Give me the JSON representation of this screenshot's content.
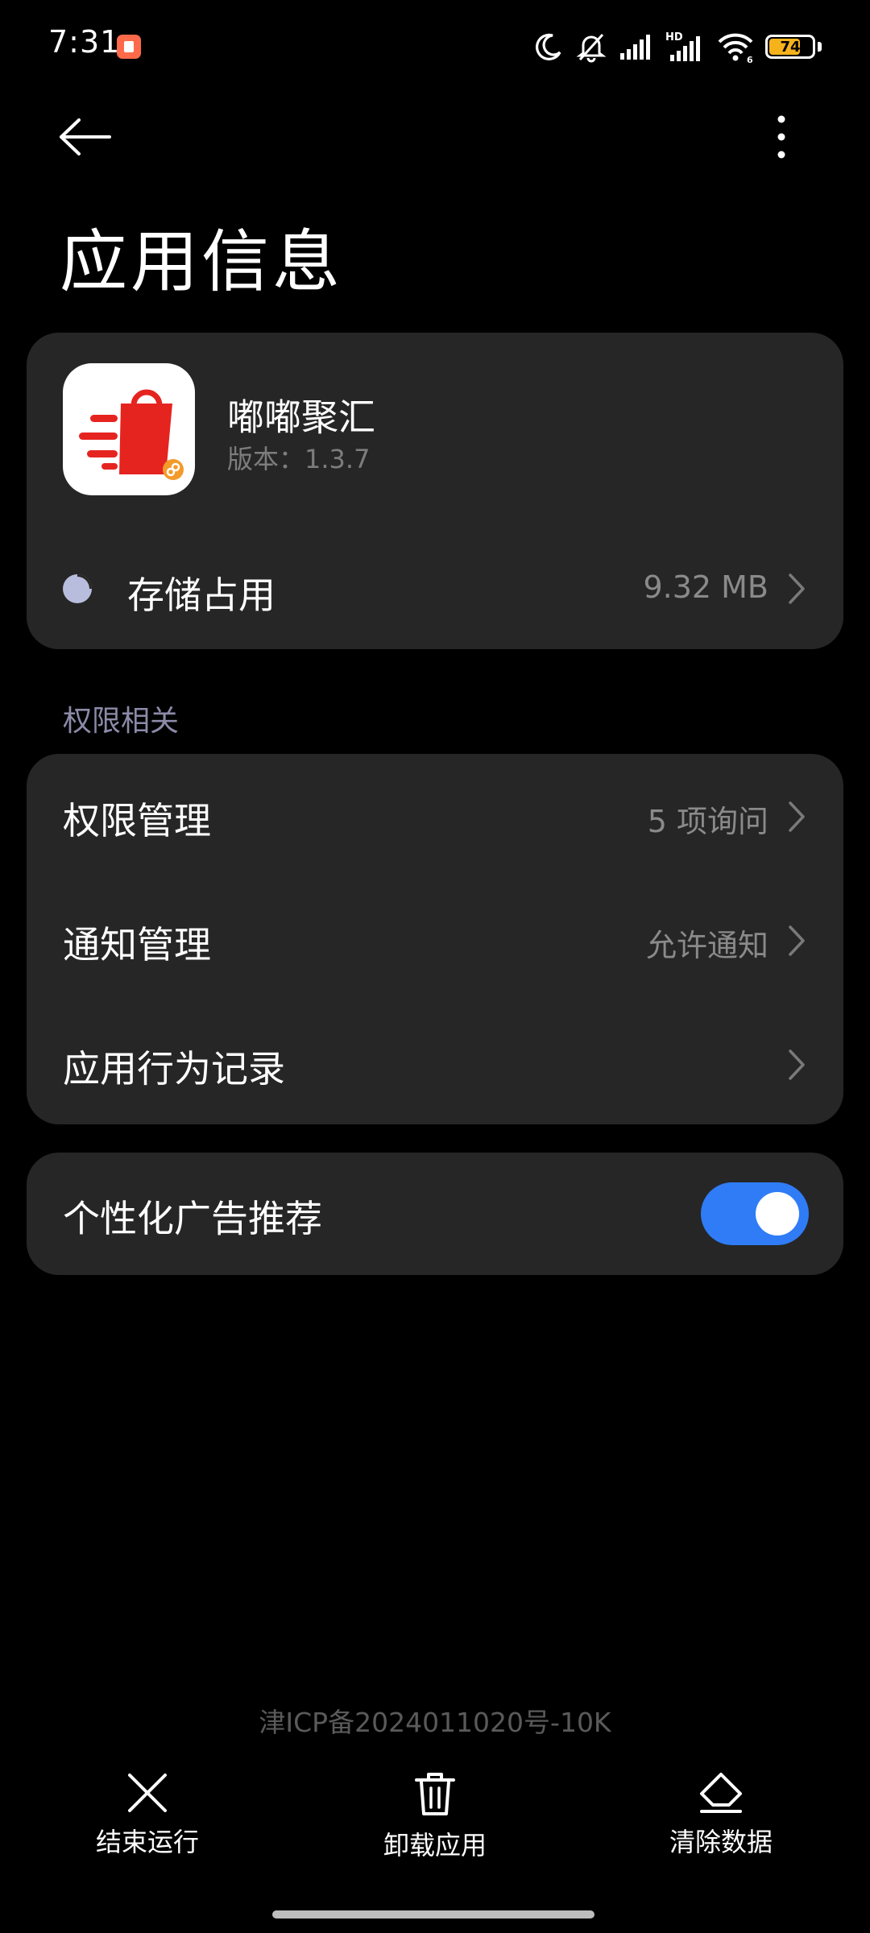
{
  "status_bar": {
    "time": "7:31",
    "battery_level": 74,
    "battery_text": "74",
    "network_label": "HD",
    "wifi_label": "6",
    "icons": [
      "app-notification-icon",
      "moon-icon",
      "bell-off-icon",
      "signal-icon",
      "signal-hd-icon",
      "wifi-icon",
      "battery-icon"
    ]
  },
  "header": {
    "title": "应用信息",
    "icons": [
      "back-arrow-icon",
      "more-vertical-icon"
    ]
  },
  "app": {
    "name": "嘟嘟聚汇",
    "version": "版本：1.3.7",
    "icon": "shopping-bag-icon"
  },
  "storage": {
    "label": "存储占用",
    "value": "9.32 MB",
    "icon": "pie-chart-icon"
  },
  "permissions_section": {
    "label": "权限相关",
    "rows": [
      {
        "label": "权限管理",
        "value": "5 项询问"
      },
      {
        "label": "通知管理",
        "value": "允许通知"
      },
      {
        "label": "应用行为记录",
        "value": ""
      }
    ]
  },
  "ads": {
    "label": "个性化广告推荐",
    "enabled": true
  },
  "icp": "津ICP备2024011020号-10K",
  "actions": [
    {
      "label": "结束运行",
      "icon": "close-icon"
    },
    {
      "label": "卸载应用",
      "icon": "trash-icon"
    },
    {
      "label": "清除数据",
      "icon": "eraser-icon"
    }
  ],
  "colors": {
    "background": "#000000",
    "card": "#262626",
    "accent": "#2f7cf6",
    "battery": "#f5b21b",
    "app_icon_red": "#e52420"
  }
}
